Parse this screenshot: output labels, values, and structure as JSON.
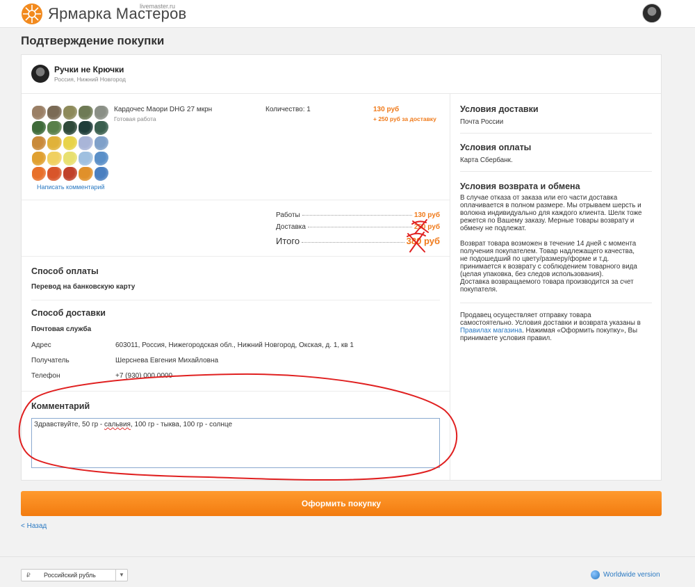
{
  "brand": {
    "name": "Ярмарка Мастеров",
    "domain": "livemaster.ru"
  },
  "page": {
    "title": "Подтверждение покупки"
  },
  "seller": {
    "name": "Ручки не Крючки",
    "location": "Россия, Нижний Новгород"
  },
  "product": {
    "title": "Кардочес Маори DHG 27 мкрн",
    "subtitle": "Готовая работа",
    "quantity_label": "Количество: 1",
    "price": "130 руб",
    "shipping": "+ 250 руб за доставку",
    "comment_link": "Написать комментарий",
    "swatches": [
      "#9a7f65",
      "#7a6a55",
      "#8d8a5a",
      "#6e7a55",
      "#8a8f86",
      "#3f6b3a",
      "#59804a",
      "#2f4a3a",
      "#1f3d3a",
      "#3a5f4e",
      "#c98a3a",
      "#e0b23a",
      "#e8d34a",
      "#a9b5d8",
      "#7fa0c9",
      "#e0a030",
      "#f0d060",
      "#e8e070",
      "#9fc0e0",
      "#5a8fc8",
      "#e8702a",
      "#d8552a",
      "#c0402a",
      "#e0902a",
      "#4a7fc0"
    ]
  },
  "summary": {
    "works_label": "Работы",
    "works_value": "130 руб",
    "delivery_label": "Доставка",
    "delivery_value": "250 руб",
    "total_label": "Итого",
    "total_value": "380 руб"
  },
  "payment": {
    "heading": "Способ оплаты",
    "method": "Перевод на банковскую карту"
  },
  "delivery": {
    "heading": "Способ доставки",
    "method": "Почтовая служба",
    "address_label": "Адрес",
    "address": "603011, Россия, Нижегородская обл., Нижний Новгород, Окская, д. 1, кв 1",
    "recipient_label": "Получатель",
    "recipient": "Шерснева Евгения Михайловна",
    "phone_label": "Телефон",
    "phone": "+7 (930) 000 0000"
  },
  "comment": {
    "heading": "Комментарий",
    "text_before": "Здравствуйте, 50 гр - ",
    "text_misspelled": "сальвия",
    "text_after": ", 100 гр - тыква, 100 гр - солнце"
  },
  "sidebar": {
    "delivery_heading": "Условия доставки",
    "delivery_text": "Почта России",
    "payment_heading": "Условия оплаты",
    "payment_text": "Карта Сбербанк.",
    "return_heading": "Условия возврата и обмена",
    "return_lines_1": [
      "В случае отказа от заказа или его части доставка",
      "оплачивается в полном размере. Мы отрываем шерсть и",
      "волокна индивидуально для каждого клиента. Шелк тоже",
      "режется по Вашему заказу. Мерные товары возврату и",
      "обмену не подлежат."
    ],
    "return_lines_2": [
      "Возврат товара возможен в течение 14 дней с момента",
      "получения покупателем. Товар надлежащего качества,",
      "не подошедший по цвету/размеру/форме и т.д.",
      "принимается к возврату с соблюдением товарного вида",
      "(целая упаковка, без следов использования).",
      "Доставка возвращаемого товара производится за счет",
      "покупателя."
    ],
    "rules_line_1": "Продавец осуществляет отправку товара",
    "rules_line_2": "самостоятельно. Условия доставки и возврата указаны в",
    "rules_link": "Правилах магазина",
    "rules_line_3_after": ". Нажимая «Оформить покупку», Вы",
    "rules_line_4": "принимаете условия правил."
  },
  "actions": {
    "buy_label": "Оформить покупку",
    "back_label": "< Назад"
  },
  "footer": {
    "currency_symbol": "₽",
    "currency": "Российский рубль",
    "worldwide": "Worldwide version"
  },
  "colors": {
    "accent": "#f07a1a",
    "link": "#2a79c2",
    "annotation": "#e02020"
  }
}
